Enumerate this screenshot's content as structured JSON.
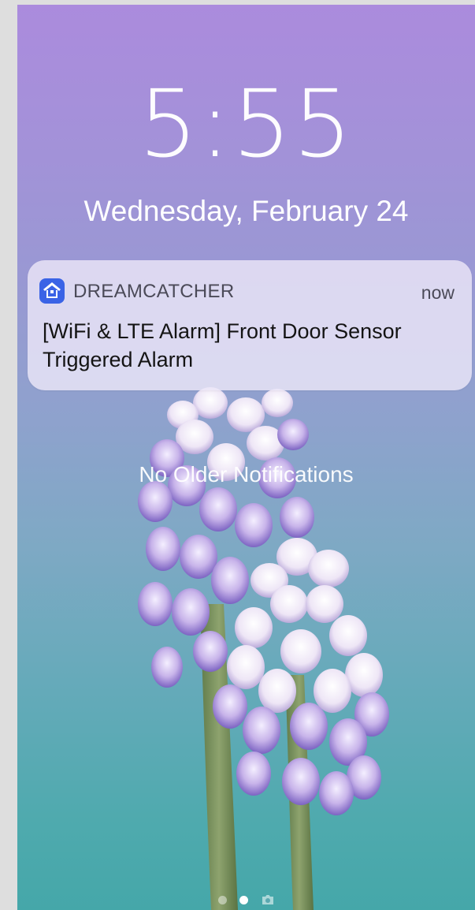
{
  "lockscreen": {
    "time": "5:55",
    "date": "Wednesday, February 24"
  },
  "notification": {
    "app_icon": "house-icon",
    "app_name": "DREAMCATCHER",
    "time": "now",
    "body": "[WiFi & LTE Alarm] Front Door Sensor Triggered Alarm"
  },
  "status_text": "No Older Notifications",
  "page_indicator": {
    "pages": [
      "dot",
      "dot-active",
      "camera-icon"
    ]
  },
  "colors": {
    "wallpaper_top": "#ab8bdd",
    "wallpaper_bottom": "#45a7a9",
    "app_icon_bg": "#3a63e6"
  }
}
